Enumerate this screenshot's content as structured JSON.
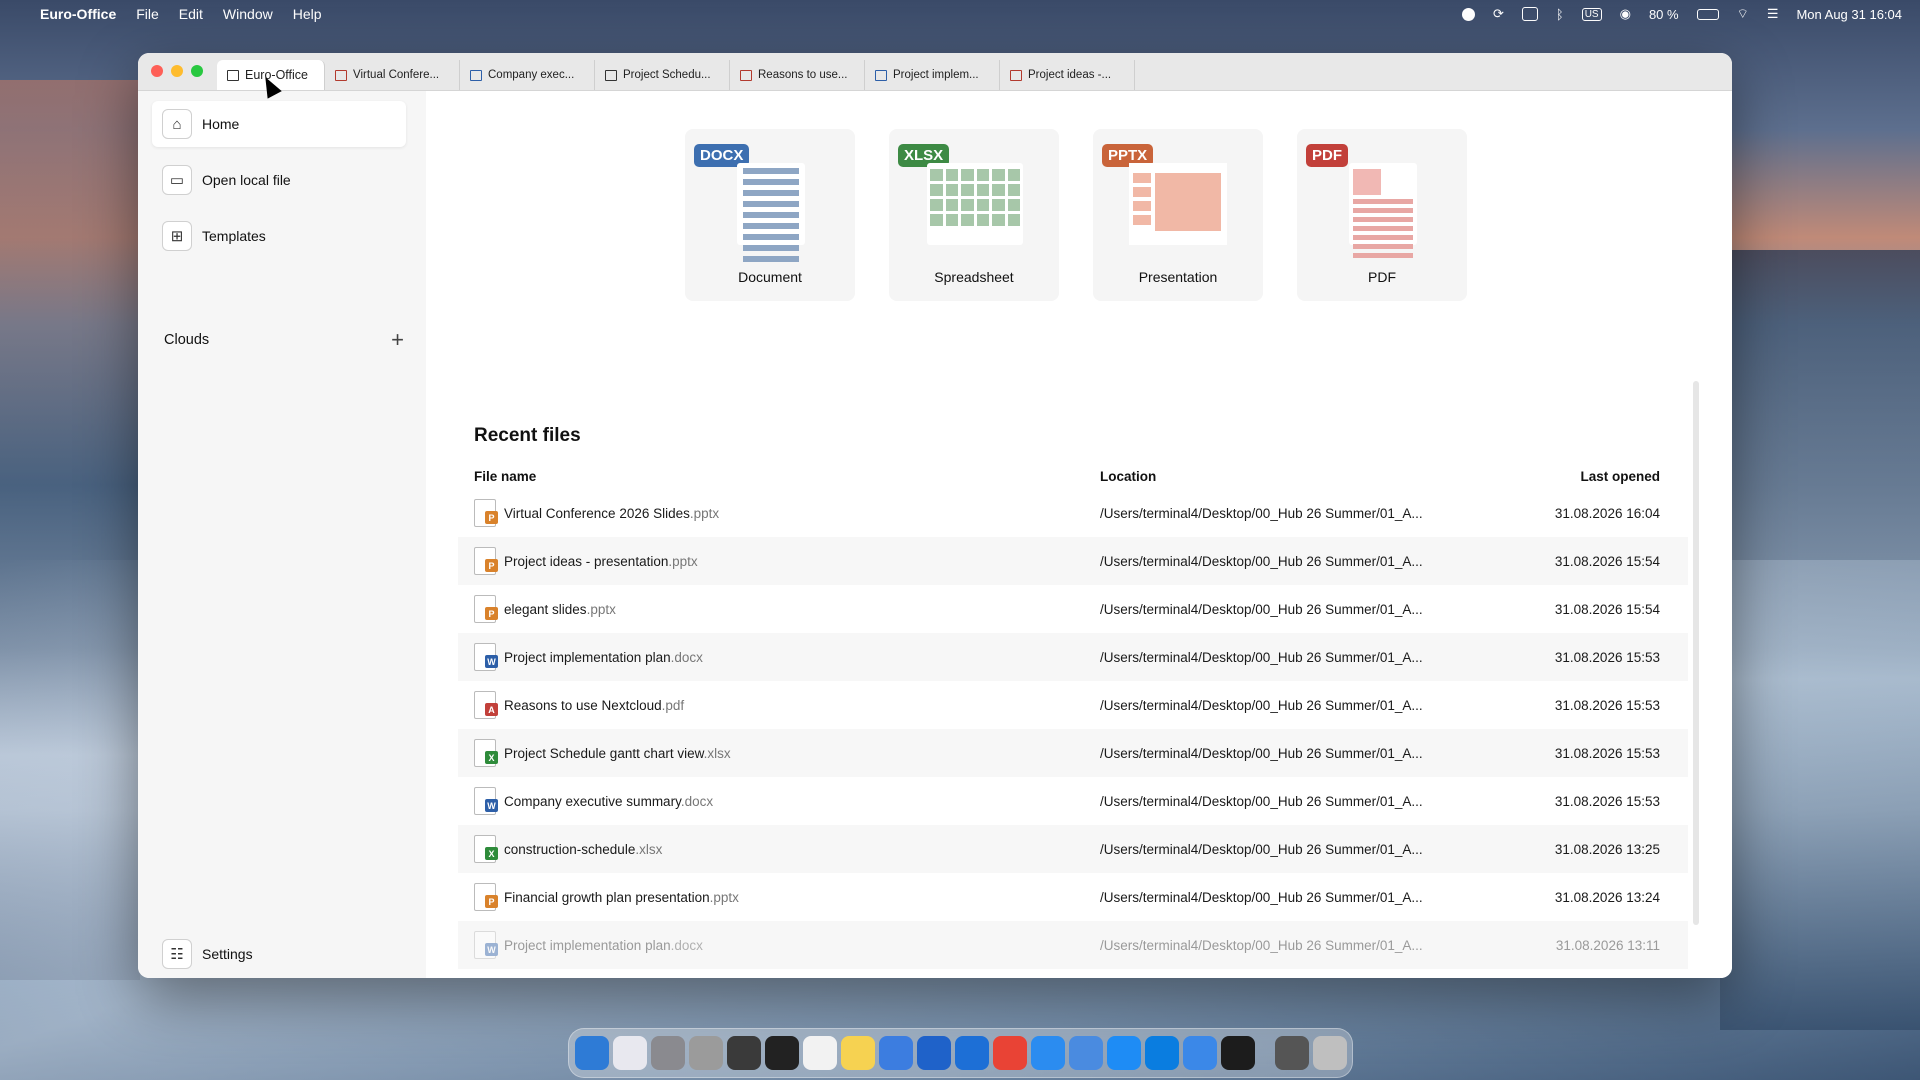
{
  "menubar": {
    "app_name": "Euro-Office",
    "menus": [
      "File",
      "Edit",
      "Window",
      "Help"
    ],
    "battery": "80 %",
    "keyboard": "US",
    "clock": "Mon Aug 31  16:04"
  },
  "tabs": [
    {
      "label": "Euro-Office",
      "icon": "home-doc-icon"
    },
    {
      "label": "Virtual Confere...",
      "icon": "presentation-icon"
    },
    {
      "label": "Company exec...",
      "icon": "document-icon"
    },
    {
      "label": "Project Schedu...",
      "icon": "spreadsheet-icon"
    },
    {
      "label": "Reasons to use...",
      "icon": "pdf-icon"
    },
    {
      "label": "Project implem...",
      "icon": "document-icon"
    },
    {
      "label": "Project ideas -...",
      "icon": "presentation-icon"
    }
  ],
  "sidebar": {
    "home": "Home",
    "open_local": "Open local file",
    "templates": "Templates",
    "clouds": "Clouds",
    "settings": "Settings"
  },
  "new_cards": [
    {
      "badge": "DOCX",
      "label": "Document",
      "color": "#3d6fb0"
    },
    {
      "badge": "XLSX",
      "label": "Spreadsheet",
      "color": "#3d8a44"
    },
    {
      "badge": "PPTX",
      "label": "Presentation",
      "color": "#c9643a"
    },
    {
      "badge": "PDF",
      "label": "PDF",
      "color": "#c2403a"
    }
  ],
  "recent": {
    "title": "Recent files",
    "headers": {
      "name": "File name",
      "location": "Location",
      "date": "Last opened"
    },
    "rows": [
      {
        "name": "Virtual Conference 2026 Slides",
        "ext": ".pptx",
        "type": "P",
        "location": "/Users/terminal4/Desktop/00_Hub 26 Summer/01_A...",
        "date": "31.08.2026 16:04"
      },
      {
        "name": "Project ideas - presentation",
        "ext": ".pptx",
        "type": "P",
        "location": "/Users/terminal4/Desktop/00_Hub 26 Summer/01_A...",
        "date": "31.08.2026 15:54"
      },
      {
        "name": "elegant slides",
        "ext": ".pptx",
        "type": "P",
        "location": "/Users/terminal4/Desktop/00_Hub 26 Summer/01_A...",
        "date": "31.08.2026 15:54"
      },
      {
        "name": "Project implementation plan",
        "ext": ".docx",
        "type": "W",
        "location": "/Users/terminal4/Desktop/00_Hub 26 Summer/01_A...",
        "date": "31.08.2026 15:53"
      },
      {
        "name": "Reasons to use Nextcloud",
        "ext": ".pdf",
        "type": "A",
        "location": "/Users/terminal4/Desktop/00_Hub 26 Summer/01_A...",
        "date": "31.08.2026 15:53"
      },
      {
        "name": "Project Schedule gantt chart view",
        "ext": ".xlsx",
        "type": "X",
        "location": "/Users/terminal4/Desktop/00_Hub 26 Summer/01_A...",
        "date": "31.08.2026 15:53"
      },
      {
        "name": "Company executive summary",
        "ext": ".docx",
        "type": "W",
        "location": "/Users/terminal4/Desktop/00_Hub 26 Summer/01_A...",
        "date": "31.08.2026 15:53"
      },
      {
        "name": "construction-schedule",
        "ext": ".xlsx",
        "type": "X",
        "location": "/Users/terminal4/Desktop/00_Hub 26 Summer/01_A...",
        "date": "31.08.2026 13:25"
      },
      {
        "name": "Financial growth plan presentation",
        "ext": ".pptx",
        "type": "P",
        "location": "/Users/terminal4/Desktop/00_Hub 26 Summer/01_A...",
        "date": "31.08.2026 13:24"
      },
      {
        "name": "Project implementation plan",
        "ext": ".docx",
        "type": "W",
        "location": "/Users/terminal4/Desktop/00_Hub 26 Summer/01_A...",
        "date": "31.08.2026 13:11"
      }
    ]
  },
  "type_colors": {
    "P": "#d9822b",
    "W": "#2d5fa8",
    "X": "#2e8b3a",
    "A": "#c2403a"
  },
  "dock": [
    "finder-icon",
    "launchpad-icon",
    "settings-icon",
    "a-icon",
    "photos-icon",
    "camera-icon",
    "text-icon",
    "notes-icon",
    "preview-icon",
    "xcode-icon",
    "browser-icon",
    "chrome-icon",
    "safari-icon",
    "mail-icon",
    "appstore-icon",
    "nextcloud-icon",
    "quicktime-icon",
    "terminal-icon",
    "folder-icon",
    "trash-icon"
  ]
}
